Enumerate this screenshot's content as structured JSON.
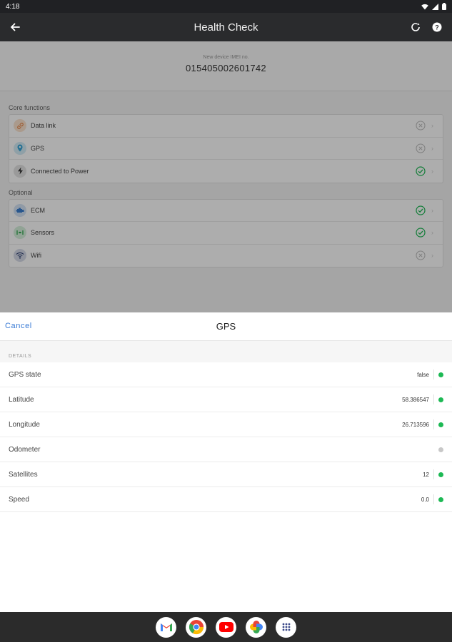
{
  "status_bar": {
    "time": "4:18"
  },
  "app_bar": {
    "title": "Health Check"
  },
  "imei": {
    "label": "New device IMEI no.",
    "value": "015405002601742"
  },
  "sections": {
    "core_label": "Core functions",
    "optional_label": "Optional"
  },
  "core_functions": [
    {
      "label": "Data link",
      "status": "inactive",
      "icon": "link-icon"
    },
    {
      "label": "GPS",
      "status": "inactive",
      "icon": "location-pin-icon"
    },
    {
      "label": "Connected to Power",
      "status": "ok",
      "icon": "bolt-icon"
    }
  ],
  "optional_functions": [
    {
      "label": "ECM",
      "status": "ok",
      "icon": "engine-icon"
    },
    {
      "label": "Sensors",
      "status": "ok",
      "icon": "sensor-icon"
    },
    {
      "label": "Wifi",
      "status": "inactive",
      "icon": "wifi-icon"
    }
  ],
  "sheet": {
    "cancel_label": "Cancel",
    "title": "GPS",
    "details_label": "DETAILS",
    "rows": [
      {
        "key": "GPS state",
        "value": "false",
        "dot": "green"
      },
      {
        "key": "Latitude",
        "value": "58.386547",
        "dot": "green"
      },
      {
        "key": "Longitude",
        "value": "26.713596",
        "dot": "green"
      },
      {
        "key": "Odometer",
        "value": "",
        "dot": "gray"
      },
      {
        "key": "Satellites",
        "value": "12",
        "dot": "green"
      },
      {
        "key": "Speed",
        "value": "0.0",
        "dot": "green"
      }
    ]
  },
  "colors": {
    "green": "#1db954",
    "gray": "#c8c8c8",
    "accent": "#3a7bd5"
  },
  "dock_apps": [
    "gmail-icon",
    "chrome-icon",
    "youtube-icon",
    "photos-icon",
    "app-drawer-icon"
  ]
}
